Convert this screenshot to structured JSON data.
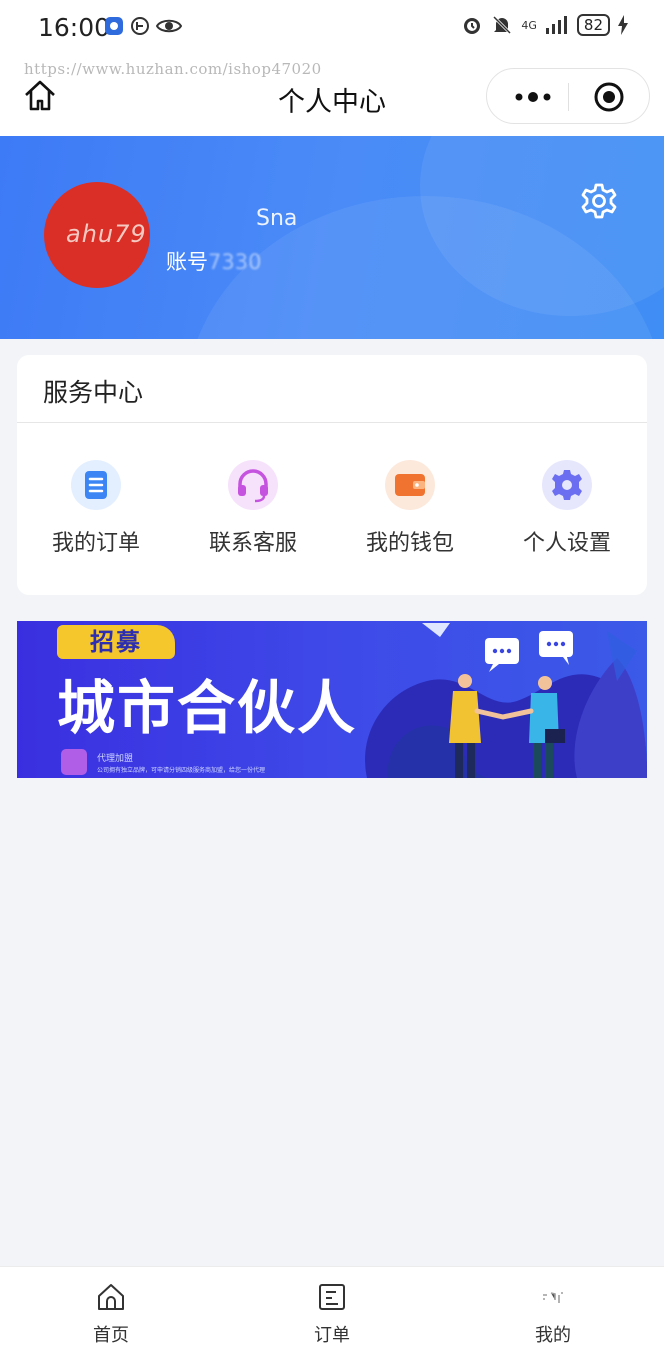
{
  "status_bar": {
    "time": "16:00",
    "network": "4G",
    "battery": "82"
  },
  "nav": {
    "watermark_url": "https://www.huzhan.com/ishop47020",
    "title": "个人中心"
  },
  "profile": {
    "avatar_text": "ahu79",
    "name": "Sna",
    "account_label": "账号",
    "account_value": "7330"
  },
  "service_center": {
    "title": "服务中心",
    "items": [
      {
        "label": "我的订单",
        "icon": "order-list-icon",
        "color": "#3b86f4"
      },
      {
        "label": "联系客服",
        "icon": "headset-icon",
        "color": "#c653e0"
      },
      {
        "label": "我的钱包",
        "icon": "wallet-icon",
        "color": "#f0742f"
      },
      {
        "label": "个人设置",
        "icon": "settings-icon",
        "color": "#6b6ef0"
      }
    ]
  },
  "promo": {
    "tag": "招募",
    "title": "城市合伙人",
    "subtitle": "代理加盟",
    "small_text": "公司拥有独立品牌，可申请分销四级服务商加盟，给您一份代理"
  },
  "tab_bar": {
    "items": [
      {
        "label": "首页",
        "icon": "home-icon"
      },
      {
        "label": "订单",
        "icon": "order-icon"
      },
      {
        "label": "我的",
        "icon": "profile-icon"
      }
    ]
  },
  "colors": {
    "primary": "#3f86f6",
    "background": "#f3f4f7",
    "avatar": "#d92f26",
    "promo_bg": "#3b45e6",
    "promo_tag": "#f6c62d"
  }
}
